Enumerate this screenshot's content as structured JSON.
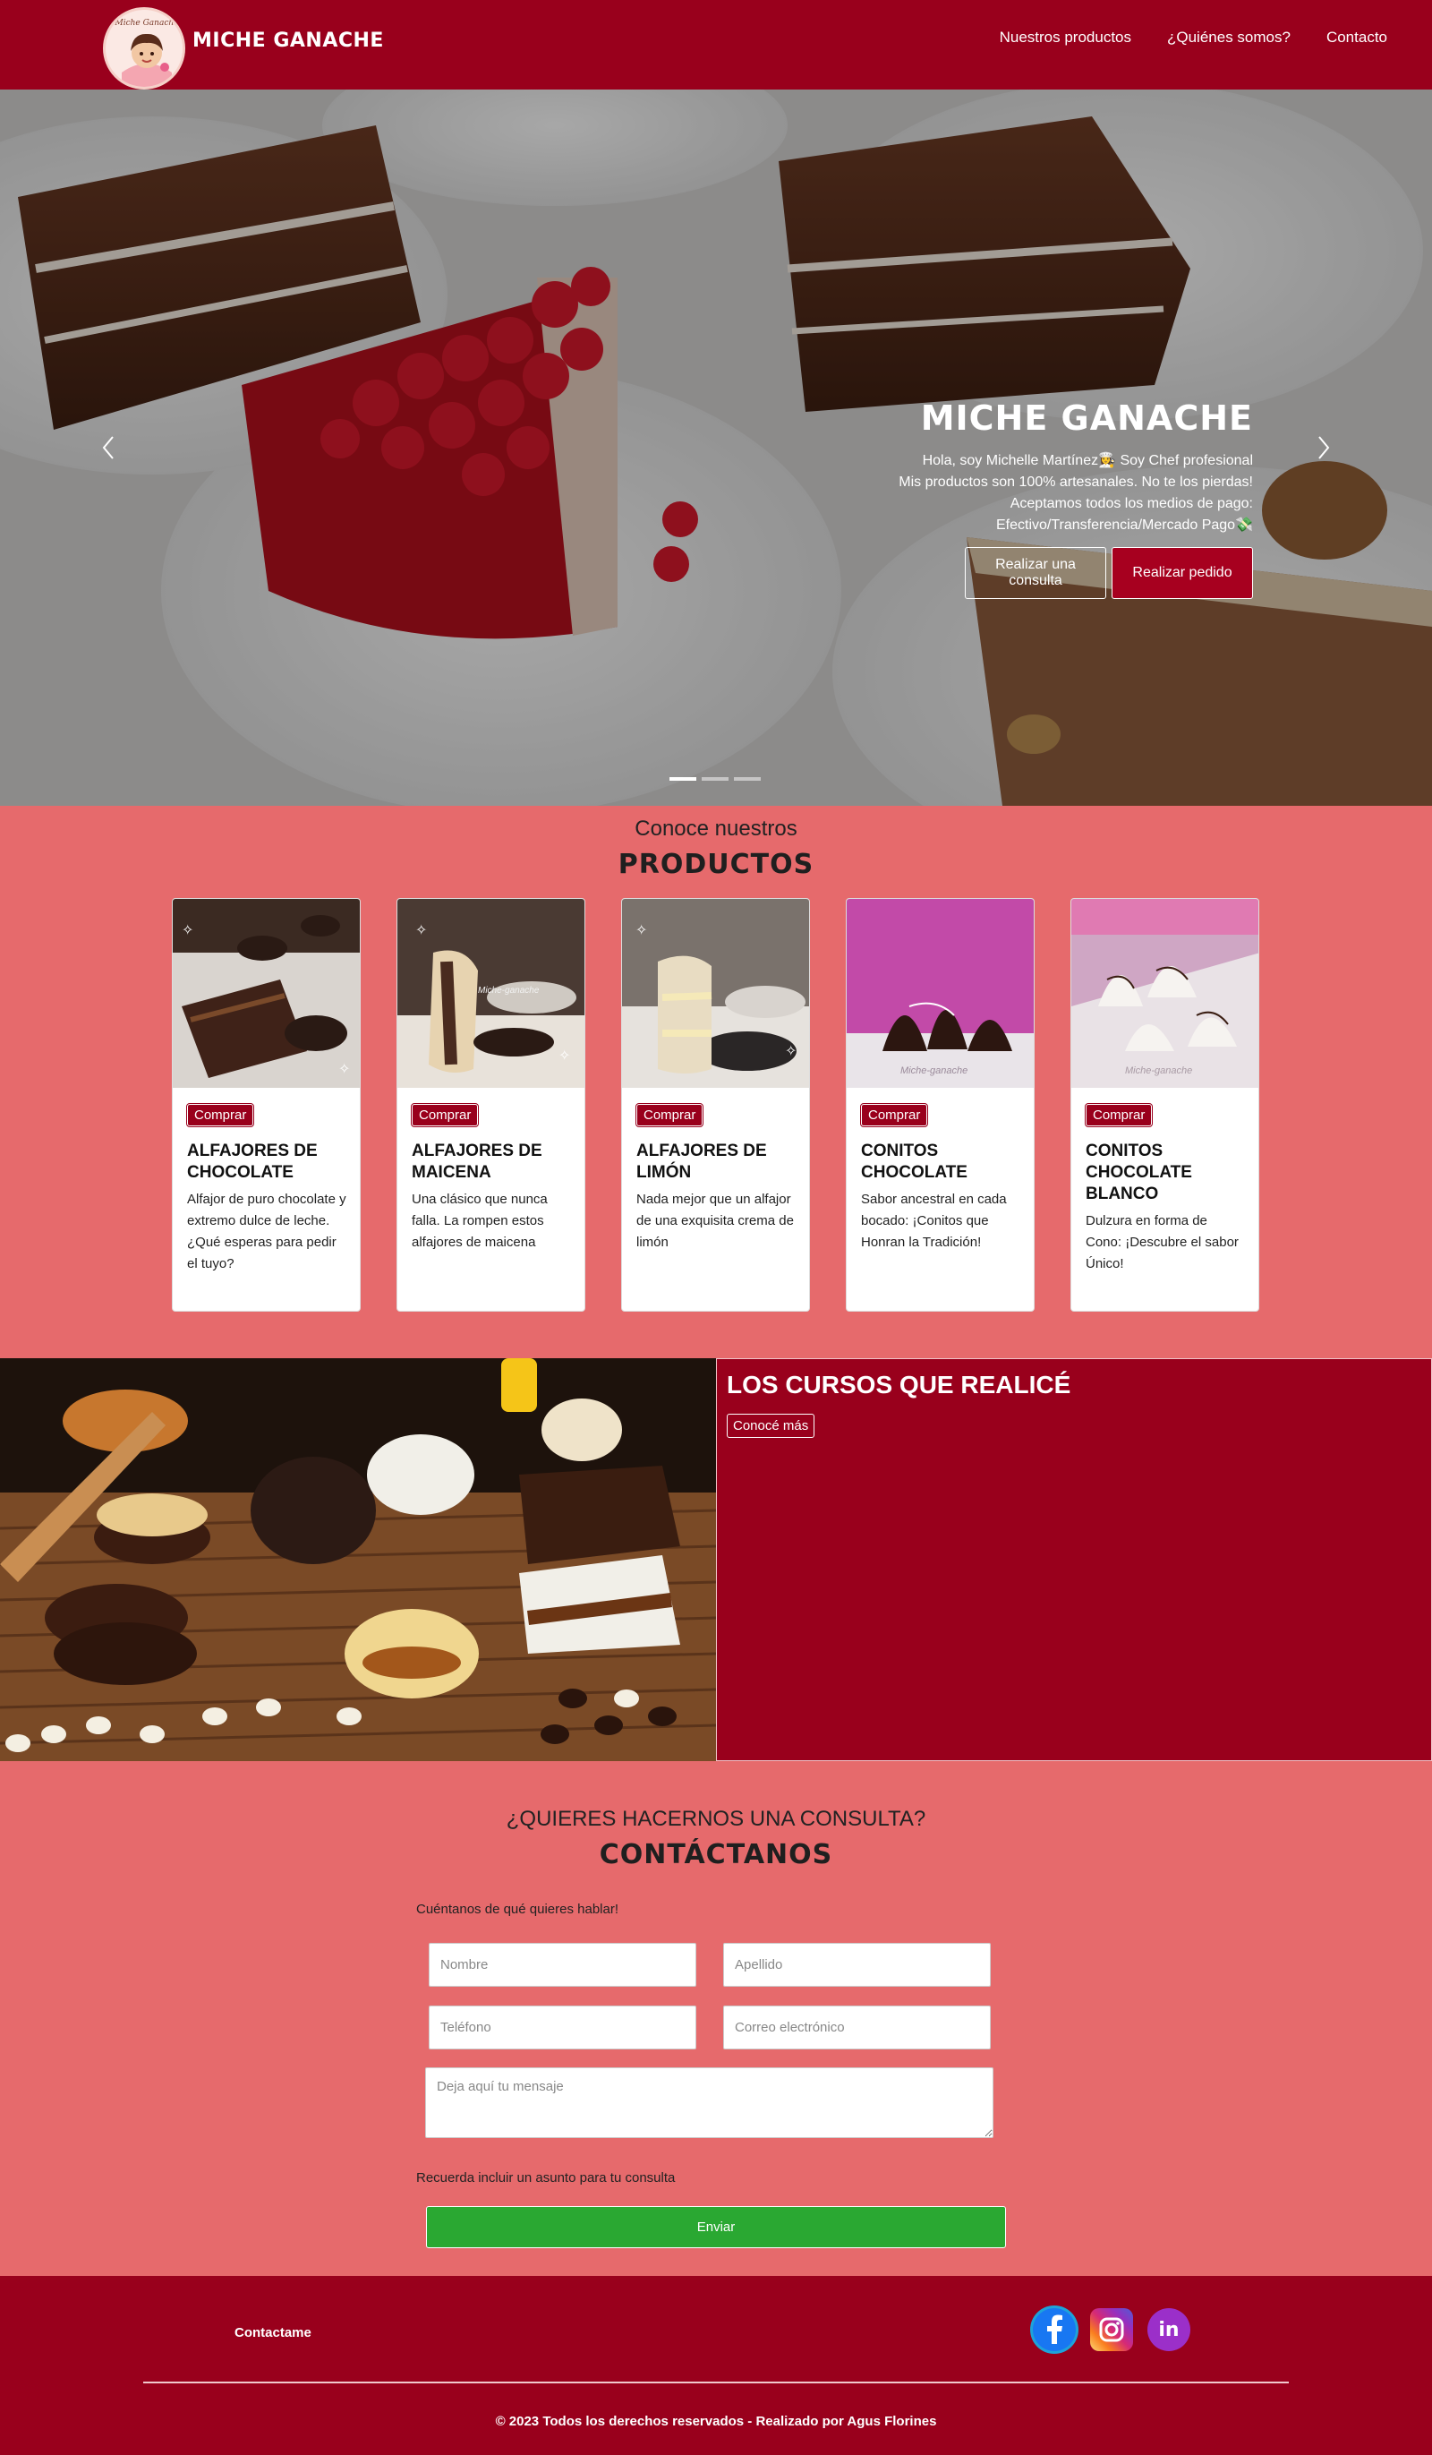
{
  "navbar": {
    "brand": "MICHE GANACHE",
    "logo_text": "Miche Ganache",
    "links": [
      "Nuestros productos",
      "¿Quiénes somos?",
      "Contacto"
    ]
  },
  "hero": {
    "title": "MICHE GANACHE",
    "lines": [
      "Hola, soy Michelle Martínez👩‍🍳 Soy Chef profesional",
      "Mis productos son 100% artesanales. No te los pierdas!",
      "Aceptamos todos los medios de pago:",
      "Efectivo/Transferencia/Mercado Pago💸"
    ],
    "btn_consulta": "Realizar una consulta",
    "btn_pedido": "Realizar pedido",
    "active_slide": 1,
    "slides": 3
  },
  "products": {
    "subtitle": "Conoce nuestros",
    "title": "PRODUCTOS",
    "buy_label": "Comprar",
    "items": [
      {
        "title": "ALFAJORES DE CHOCOLATE",
        "text": "Alfajor de puro chocolate y extremo dulce de leche. ¿Qué esperas para pedir el tuyo?"
      },
      {
        "title": "ALFAJORES DE MAICENA",
        "text": "Una clásico que nunca falla. La rompen estos alfajores de maicena"
      },
      {
        "title": "ALFAJORES DE LIMÓN",
        "text": "Nada mejor que un alfajor de una exquisita crema de limón"
      },
      {
        "title": "CONITOS CHOCOLATE",
        "text": "Sabor ancestral en cada bocado: ¡Conitos que Honran la Tradición!"
      },
      {
        "title": "CONITOS CHOCOLATE BLANCO",
        "text": "Dulzura en forma de Cono: ¡Descubre el sabor Único!"
      }
    ],
    "watermark": "Miche-ganache"
  },
  "courses": {
    "title": "LOS CURSOS QUE REALICÉ",
    "button": "Conocé más"
  },
  "contact": {
    "subtitle": "¿QUIERES HACERNOS UNA CONSULTA?",
    "title": "CONTÁCTANOS",
    "intro": "Cuéntanos de qué quieres hablar!",
    "placeholders": {
      "nombre": "Nombre",
      "apellido": "Apellido",
      "telefono": "Teléfono",
      "email": "Correo electrónico",
      "mensaje": "Deja aquí tu mensaje"
    },
    "note": "Recuerda incluir un asunto para tu consulta",
    "send": "Enviar"
  },
  "footer": {
    "contact_label": "Contactame",
    "socials": [
      "facebook-icon",
      "instagram-icon",
      "linkedin-icon"
    ],
    "linkedin_text": "in",
    "copyright": "© 2023 Todos los derechos reservados - Realizado por Agus Florines"
  },
  "colors": {
    "primary": "#99001c",
    "section_bg": "#e66a6c",
    "send_button": "#2aa832"
  }
}
